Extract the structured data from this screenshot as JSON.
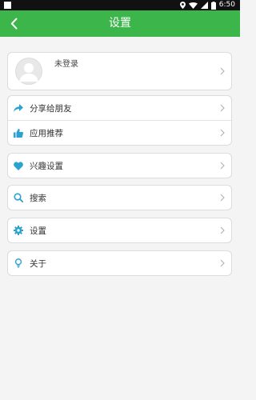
{
  "status_bar": {
    "time": "6:50"
  },
  "header": {
    "title": "设置"
  },
  "profile": {
    "name": "未登录"
  },
  "menu": {
    "share": "分享给朋友",
    "recommend": "应用推荐",
    "interest": "兴趣设置",
    "search": "搜索",
    "settings": "设置",
    "about": "关于"
  },
  "colors": {
    "accent": "#3cb54a",
    "icon": "#2aa3d3"
  }
}
